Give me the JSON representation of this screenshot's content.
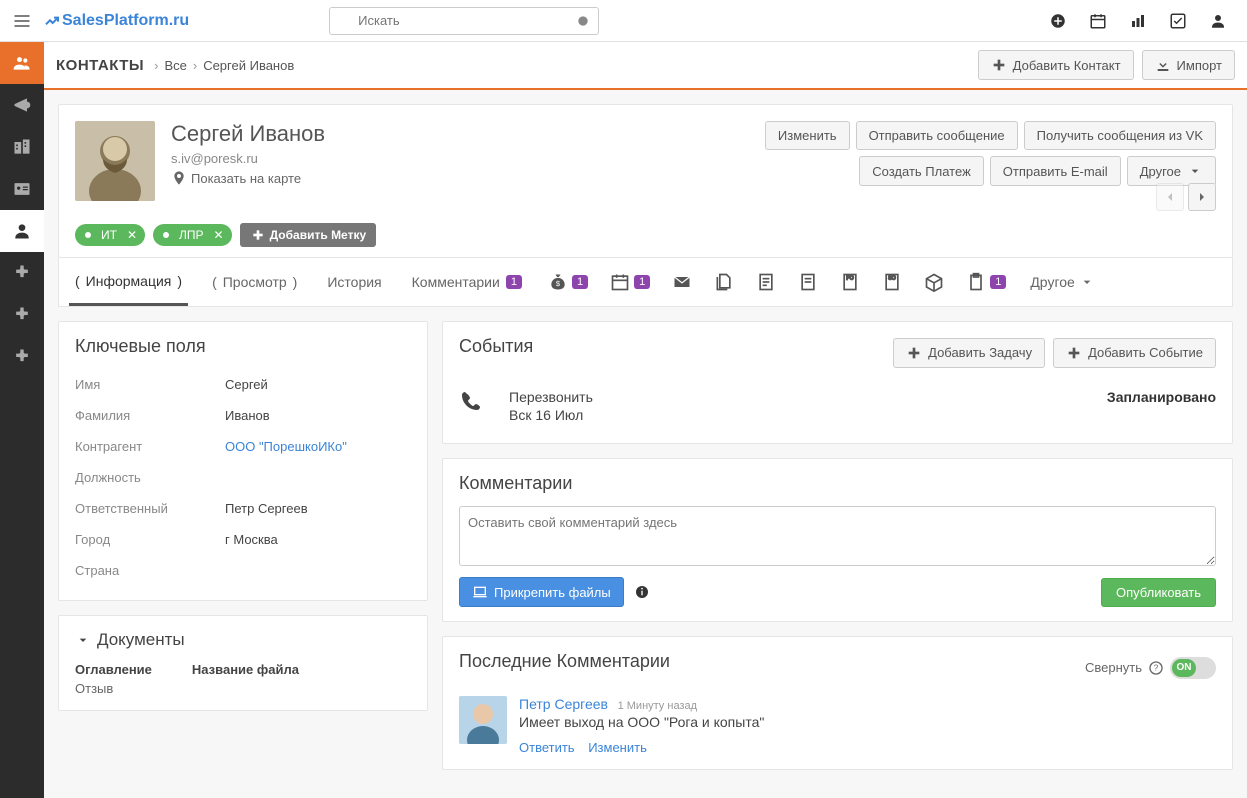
{
  "brand": "SalesPlatform.ru",
  "search": {
    "placeholder": "Искать"
  },
  "header": {
    "module": "КОНТАКТЫ",
    "crumb_all": "Все",
    "crumb_name": "Сергей Иванов",
    "add_contact": "Добавить Контакт",
    "import": "Импорт"
  },
  "record": {
    "name": "Сергей Иванов",
    "email": "s.iv@poresk.ru",
    "map_link": "Показать на карте",
    "actions": {
      "edit": "Изменить",
      "send_msg": "Отправить сообщение",
      "get_vk": "Получить сообщения из VK",
      "create_payment": "Создать Платеж",
      "send_email": "Отправить E-mail",
      "other": "Другое"
    },
    "tags": [
      "ИТ",
      "ЛПР"
    ],
    "add_tag": "Добавить Метку"
  },
  "tabs": {
    "info": "Информация",
    "view": "Просмотр",
    "history": "История",
    "comments": "Комментарии",
    "comments_badge": "1",
    "money_badge": "1",
    "calendar_badge": "1",
    "doc_badge": "1",
    "other": "Другое"
  },
  "key_fields_title": "Ключевые поля",
  "kv": {
    "name_l": "Имя",
    "name_v": "Сергей",
    "surname_l": "Фамилия",
    "surname_v": "Иванов",
    "account_l": "Контрагент",
    "account_v": "ООО \"ПорешкоИКо\"",
    "position_l": "Должность",
    "position_v": "",
    "owner_l": "Ответственный",
    "owner_v": "Петр Сергеев",
    "city_l": "Город",
    "city_v": "г Москва",
    "country_l": "Страна",
    "country_v": ""
  },
  "documents": {
    "title": "Документы",
    "col1_label": "Оглавление",
    "col1_value": "Отзыв",
    "col2_label": "Название файла"
  },
  "events": {
    "title": "События",
    "add_task": "Добавить Задачу",
    "add_event": "Добавить Событие",
    "item_title": "Перезвонить",
    "item_date": "Вск 16 Июл",
    "item_status": "Запланировано"
  },
  "comments": {
    "title": "Комментарии",
    "placeholder": "Оставить свой комментарий здесь",
    "attach": "Прикрепить файлы",
    "publish": "Опубликовать"
  },
  "recent": {
    "title": "Последние Комментарии",
    "collapse": "Свернуть",
    "toggle_label": "ON",
    "author": "Петр Сергеев",
    "time": "1 Минуту назад",
    "text": "Имеет выход на ООО \"Рога и копыта\"",
    "reply": "Ответить",
    "edit": "Изменить"
  }
}
